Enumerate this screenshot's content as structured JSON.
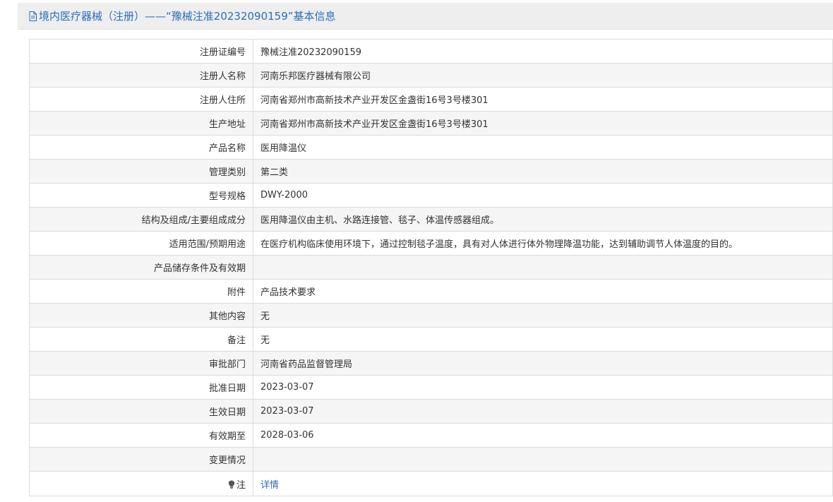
{
  "header": {
    "icon": "document-icon",
    "title": "境内医疗器械（注册）——“豫械注准20232090159”基本信息",
    "title_color": "#2a6ebb"
  },
  "table": {
    "rows": [
      {
        "label": "注册证编号",
        "value": "豫械注准20232090159"
      },
      {
        "label": "注册人名称",
        "value": "河南乐邦医疗器械有限公司"
      },
      {
        "label": "注册人住所",
        "value": "河南省郑州市高新技术产业开发区金盏街16号3号楼301"
      },
      {
        "label": "生产地址",
        "value": "河南省郑州市高新技术产业开发区金盏街16号3号楼301"
      },
      {
        "label": "产品名称",
        "value": "医用降温仪"
      },
      {
        "label": "管理类别",
        "value": "第二类"
      },
      {
        "label": "型号规格",
        "value": "DWY-2000"
      },
      {
        "label": "结构及组成/主要组成成分",
        "value": "医用降温仪由主机、水路连接管、毯子、体温传感器组成。"
      },
      {
        "label": "适用范围/预期用途",
        "value": "在医疗机构临床使用环境下，通过控制毯子温度，具有对人体进行体外物理降温功能，达到辅助调节人体温度的目的。"
      },
      {
        "label": "产品储存条件及有效期",
        "value": ""
      },
      {
        "label": "附件",
        "value": "产品技术要求"
      },
      {
        "label": "其他内容",
        "value": "无"
      },
      {
        "label": "备注",
        "value": "无"
      },
      {
        "label": "审批部门",
        "value": "河南省药品监督管理局"
      },
      {
        "label": "批准日期",
        "value": "2023-03-07"
      },
      {
        "label": "生效日期",
        "value": "2023-03-07"
      },
      {
        "label": "有效期至",
        "value": "2028-03-06"
      },
      {
        "label": "变更情况",
        "value": ""
      }
    ],
    "note_row": {
      "icon": "lightbulb-icon",
      "label": "注",
      "link_text": "详情",
      "link_color": "#2a6ebb"
    }
  }
}
